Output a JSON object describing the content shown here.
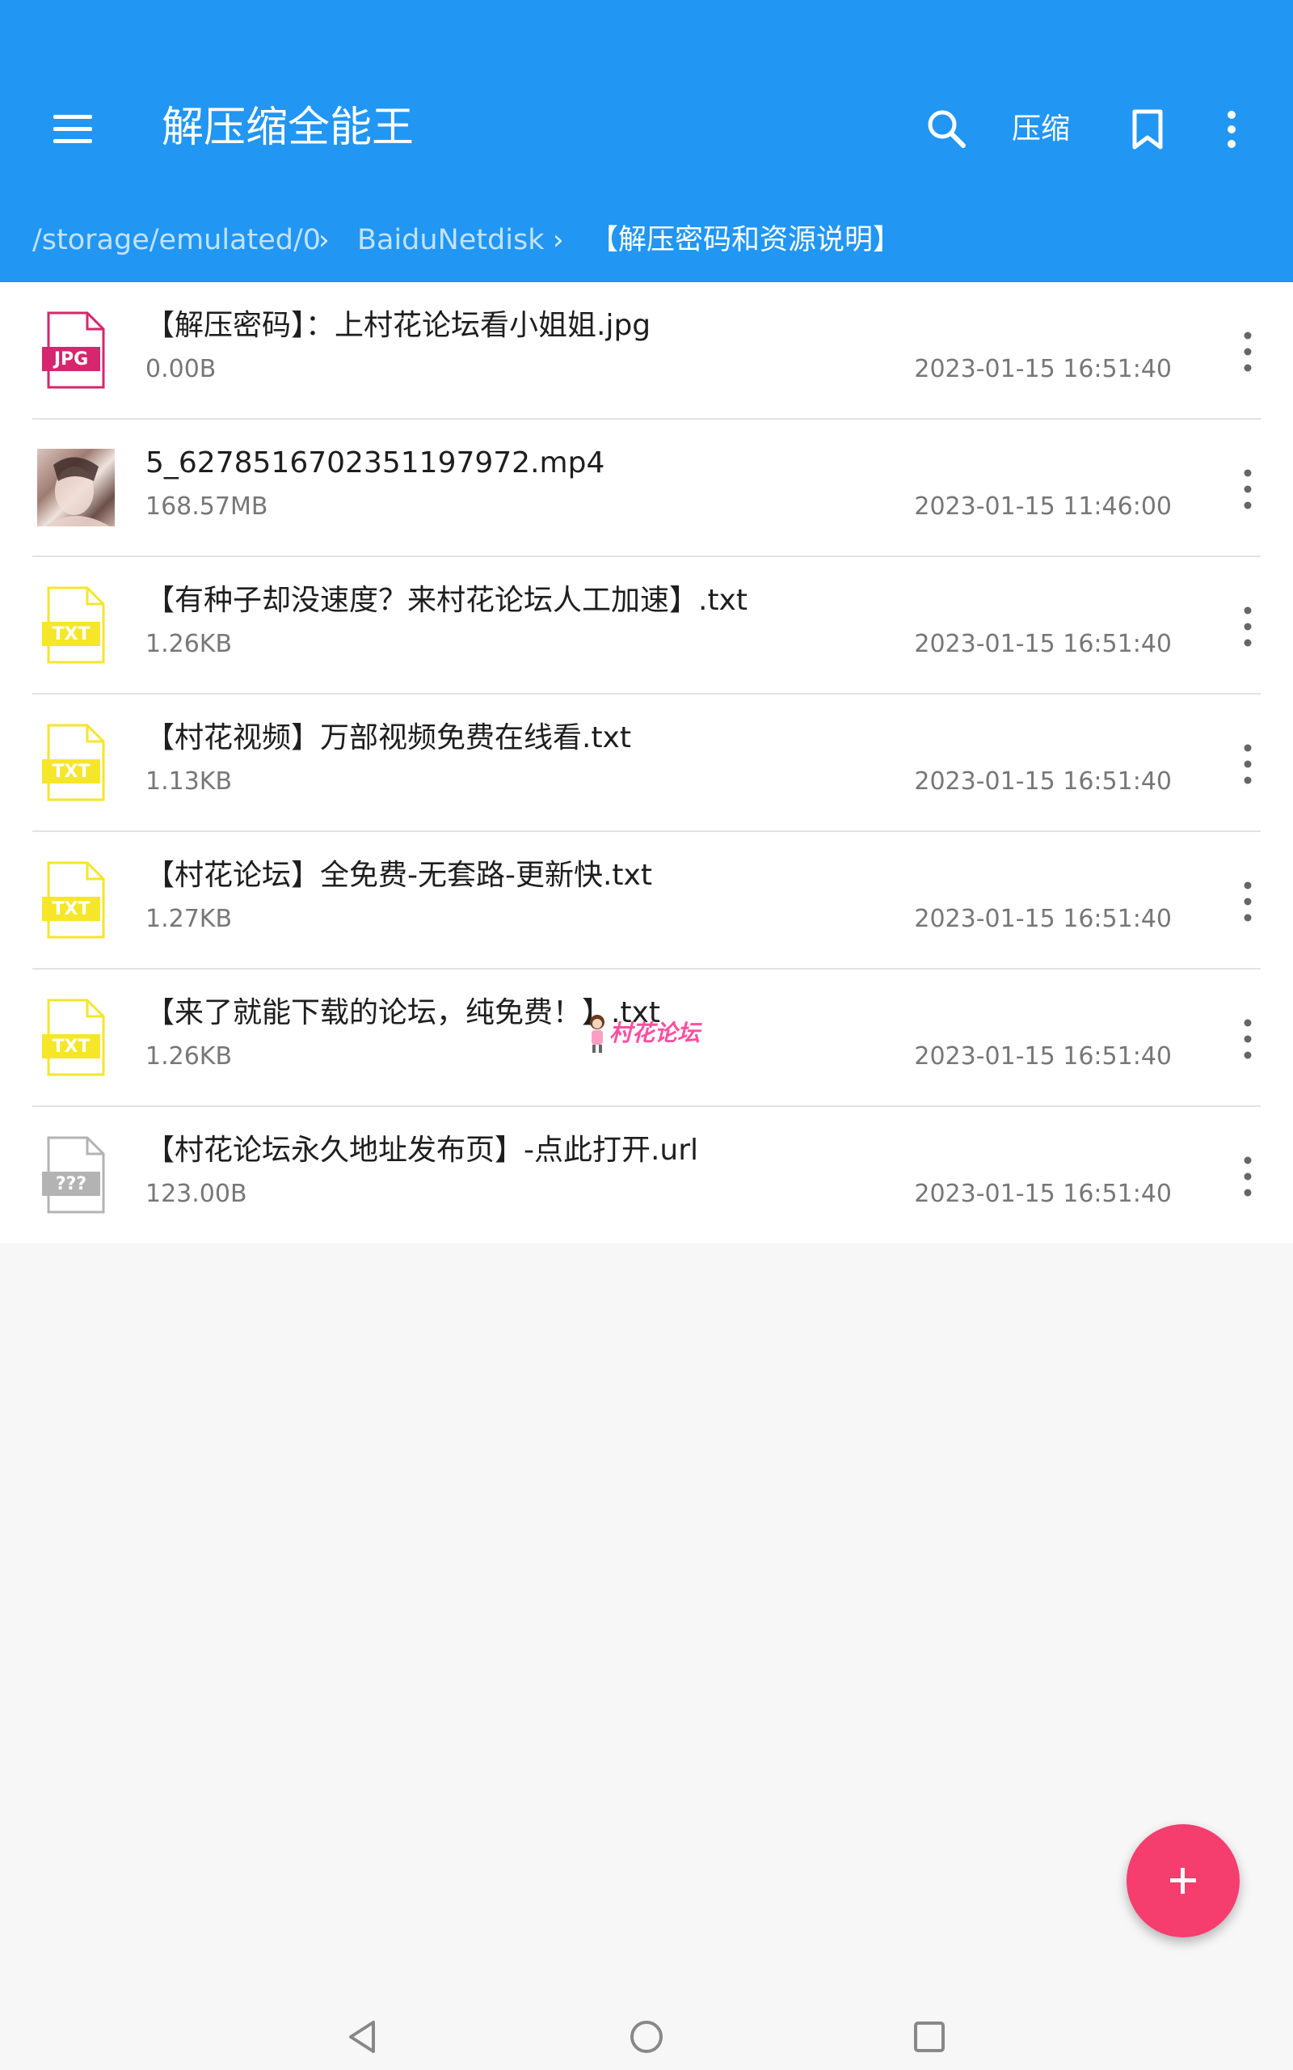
{
  "colors": {
    "primary": "#2196f3",
    "accent": "#f53d6e",
    "jpg_badge": "#d6266e",
    "txt_badge": "#f5e62a",
    "unknown_badge": "#b3b3b3"
  },
  "appbar": {
    "title": "解压缩全能王",
    "menu_icon": "hamburger-menu-icon",
    "search_icon": "search-icon",
    "compress_label": "压缩",
    "bookmark_icon": "bookmark-icon",
    "more_icon": "more-vert-icon"
  },
  "breadcrumb": {
    "items": [
      "/storage/emulated/0",
      "BaiduNetdisk",
      "【解压密码和资源说明】"
    ],
    "separator": "›"
  },
  "files": [
    {
      "name": "【解压密码】：上村花论坛看小姐姐.jpg",
      "size": "0.00B",
      "date": "2023-01-15 16:51:40",
      "type": "JPG"
    },
    {
      "name": "5_6278516702351197972.mp4",
      "size": "168.57MB",
      "date": "2023-01-15 11:46:00",
      "type": "thumbnail"
    },
    {
      "name": "【有种子却没速度？来村花论坛人工加速】.txt",
      "size": "1.26KB",
      "date": "2023-01-15 16:51:40",
      "type": "TXT"
    },
    {
      "name": "【村花视频】万部视频免费在线看.txt",
      "size": "1.13KB",
      "date": "2023-01-15 16:51:40",
      "type": "TXT"
    },
    {
      "name": "【村花论坛】全免费-无套路-更新快.txt",
      "size": "1.27KB",
      "date": "2023-01-15 16:51:40",
      "type": "TXT"
    },
    {
      "name": "【来了就能下载的论坛，纯免费！】.txt",
      "size": "1.26KB",
      "date": "2023-01-15 16:51:40",
      "type": "TXT"
    },
    {
      "name": "【村花论坛永久地址发布页】-点此打开.url",
      "size": "123.00B",
      "date": "2023-01-15 16:51:40",
      "type": "???"
    }
  ],
  "watermark": {
    "text": "村花论坛"
  },
  "fab": {
    "icon": "plus-icon"
  },
  "navbar": {
    "back_icon": "nav-back-icon",
    "home_icon": "nav-home-icon",
    "recents_icon": "nav-recents-icon"
  }
}
